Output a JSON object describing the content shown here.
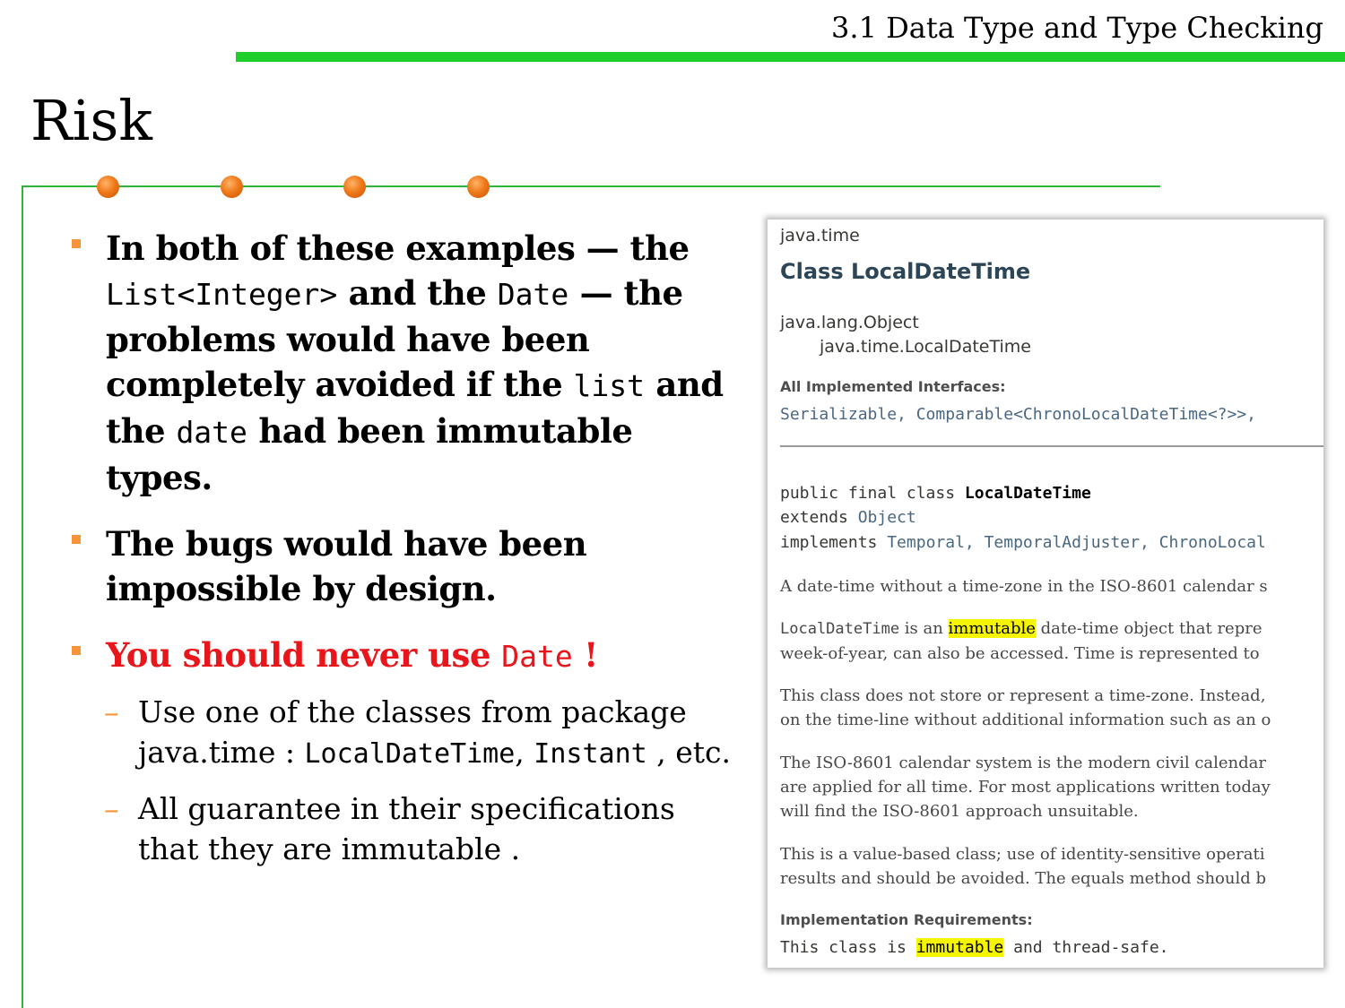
{
  "header": {
    "title": "3.1 Data Type and Type Checking"
  },
  "slide": {
    "title": "Risk"
  },
  "bullets": {
    "b1": {
      "part1": "In both of these examples — the",
      "code1": "List<Integer>",
      "part2": "and the",
      "code2": "Date",
      "part3": "— the problems would have been completely avoided if the",
      "code3": "list",
      "part4": "and the",
      "code4": "date",
      "part5": "had been immutable types."
    },
    "b2": {
      "text": "The bugs would have been impossible by design."
    },
    "b3": {
      "part1": "You should never use",
      "code": "Date",
      "part2": "!"
    },
    "s1": {
      "part1": "Use one of the classes from package java.time :",
      "code1": "LocalDateTime",
      "comma1": ",",
      "code2": "Instant",
      "comma2": ",",
      "part2": "etc."
    },
    "s2": {
      "text": "All guarantee in their specifications that they are immutable ."
    }
  },
  "javadoc": {
    "package": "java.time",
    "class_title": "Class LocalDateTime",
    "hierarchy": [
      "java.lang.Object",
      "java.time.LocalDateTime"
    ],
    "interfaces_label": "All Implemented Interfaces:",
    "interfaces": "Serializable, Comparable<ChronoLocalDateTime<?>>,",
    "signature": {
      "line1_prefix": "public final class ",
      "line1_name": "LocalDateTime",
      "line2_prefix": "extends ",
      "line2_link": "Object",
      "line3_prefix": "implements ",
      "line3_links": "Temporal, TemporalAdjuster, ChronoLocal"
    },
    "para1": "A date-time without a time-zone in the ISO-8601 calendar s",
    "para2": {
      "code": "LocalDateTime",
      "pre": " is an ",
      "highlight": "immutable",
      "post": " date-time object that repre",
      "line2": "week-of-year, can also be accessed. Time is represented to"
    },
    "para3": [
      "This class does not store or represent a time-zone. Instead,",
      "on the time-line without additional information such as an o"
    ],
    "para4": [
      "The ISO-8601 calendar system is the modern civil calendar",
      "are applied for all time. For most applications written today",
      "will find the ISO-8601 approach unsuitable."
    ],
    "para5": [
      "This is a value-based class; use of identity-sensitive operati",
      "results and should be avoided. The equals method should b"
    ],
    "impl_label": "Implementation Requirements:",
    "impl": {
      "pre": "This class is ",
      "highlight": "immutable",
      "post": " and thread-safe."
    }
  }
}
